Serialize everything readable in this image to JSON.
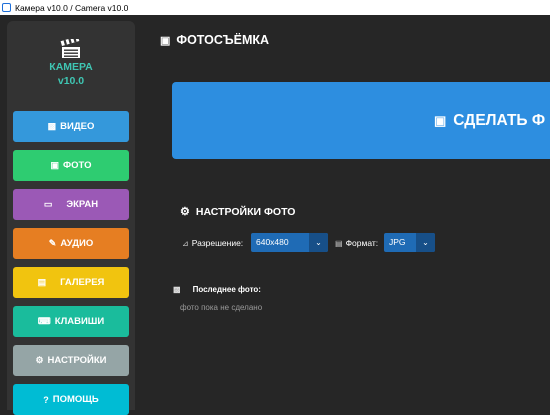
{
  "window": {
    "title": "Камера v10.0 / Camera v10.0"
  },
  "logo": {
    "title_line1": "КАМЕРА",
    "title_line2": "v10.0",
    "icon": "clapperboard-icon"
  },
  "sidebar": {
    "items": [
      {
        "label": "ВИДЕО",
        "icon": "video-icon",
        "color": "#3498db"
      },
      {
        "label": "ФОТО",
        "icon": "camera-icon",
        "color": "#2ecc71"
      },
      {
        "label": "ЭКРАН",
        "icon": "monitor-icon",
        "color": "#9b59b6"
      },
      {
        "label": "АУДИО",
        "icon": "microphone-icon",
        "color": "#e67e22"
      },
      {
        "label": "ГАЛЕРЕЯ",
        "icon": "gallery-icon",
        "color": "#f1c40f"
      },
      {
        "label": "КЛАВИШИ",
        "icon": "keyboard-icon",
        "color": "#1abc9c"
      },
      {
        "label": "НАСТРОЙКИ",
        "icon": "gear-icon",
        "color": "#95a5a6"
      },
      {
        "label": "ПОМОЩЬ",
        "icon": "question-icon",
        "color": "#00bcd4"
      }
    ]
  },
  "main": {
    "header": "ФОТОСЪЁМКА",
    "capture_button": "СДЕЛАТЬ Ф",
    "settings_title": "НАСТРОЙКИ ФОТО",
    "resolution": {
      "label": "Разрешение:",
      "value": "640x480"
    },
    "format": {
      "label": "Формат:",
      "value": "JPG"
    },
    "last_photo": {
      "label": "Последнее фото:",
      "value": "фото пока не сделано"
    }
  },
  "colors": {
    "accent": "#2d8ee0",
    "background": "#262626",
    "sidebar": "#333333",
    "logo_text": "#3fc6b3"
  }
}
